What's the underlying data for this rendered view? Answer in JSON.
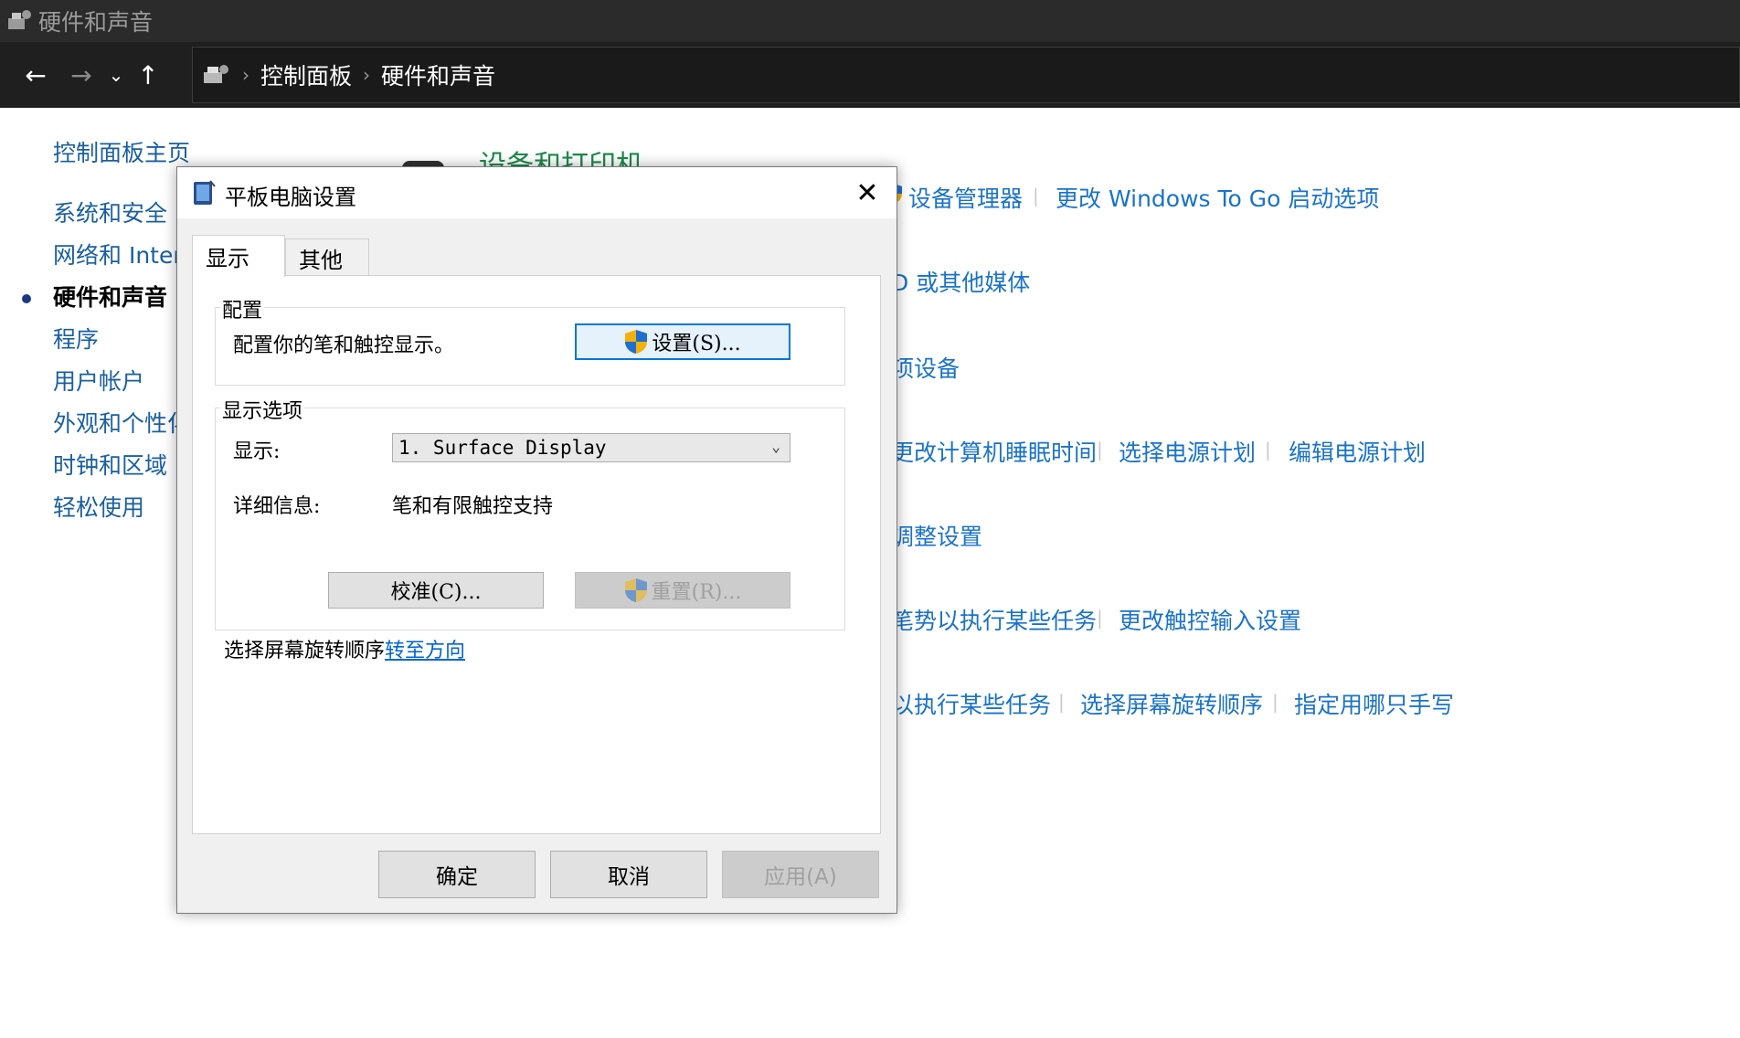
{
  "window": {
    "title": "硬件和声音"
  },
  "nav": {
    "breadcrumbs": [
      "控制面板",
      "硬件和声音"
    ]
  },
  "sidebar": {
    "items": [
      {
        "label": "控制面板主页"
      },
      {
        "label": "系统和安全"
      },
      {
        "label": "网络和 Inter"
      },
      {
        "label": "硬件和声音",
        "active": true
      },
      {
        "label": "程序"
      },
      {
        "label": "用户帐户"
      },
      {
        "label": "外观和个性化"
      },
      {
        "label": "时钟和区域"
      },
      {
        "label": "轻松使用"
      }
    ]
  },
  "content": {
    "section_title": "设备和打印机",
    "links": {
      "device_manager": "设备管理器",
      "windows_to_go": "更改 Windows To Go 启动选项",
      "cd_media": "D 或其他媒体",
      "devices": "项设备",
      "sleep_time": "更改计算机睡眠时间",
      "power_plan": "选择电源计划",
      "edit_power_plan": "编辑电源计划",
      "adjust_settings": "调整设置",
      "pen_gestures": "笔势以执行某些任务",
      "touch_input": "更改触控输入设置",
      "touch_tasks": "以执行某些任务",
      "rotation_order": "选择屏幕旋转顺序",
      "handedness": "指定用哪只手写"
    }
  },
  "dialog": {
    "title": "平板电脑设置",
    "tabs": [
      "显示",
      "其他"
    ],
    "config_group": {
      "label": "配置",
      "description": "配置你的笔和触控显示。",
      "settings_button": "设置(S)..."
    },
    "display_group": {
      "label": "显示选项",
      "display_label": "显示:",
      "display_value": "1. Surface Display",
      "details_label": "详细信息:",
      "details_value": "笔和有限触控支持",
      "calibrate_button": "校准(C)...",
      "reset_button": "重置(R)..."
    },
    "rotation_text": "选择屏幕旋转顺序",
    "rotation_link": "转至方向",
    "buttons": {
      "ok": "确定",
      "cancel": "取消",
      "apply": "应用(A)"
    }
  },
  "colors": {
    "link": "#1a73c7",
    "section_title": "#1e8a4a",
    "titlebar": "#2b2b2b",
    "navbar": "#1f1f1f",
    "focus": "#0078d7"
  }
}
